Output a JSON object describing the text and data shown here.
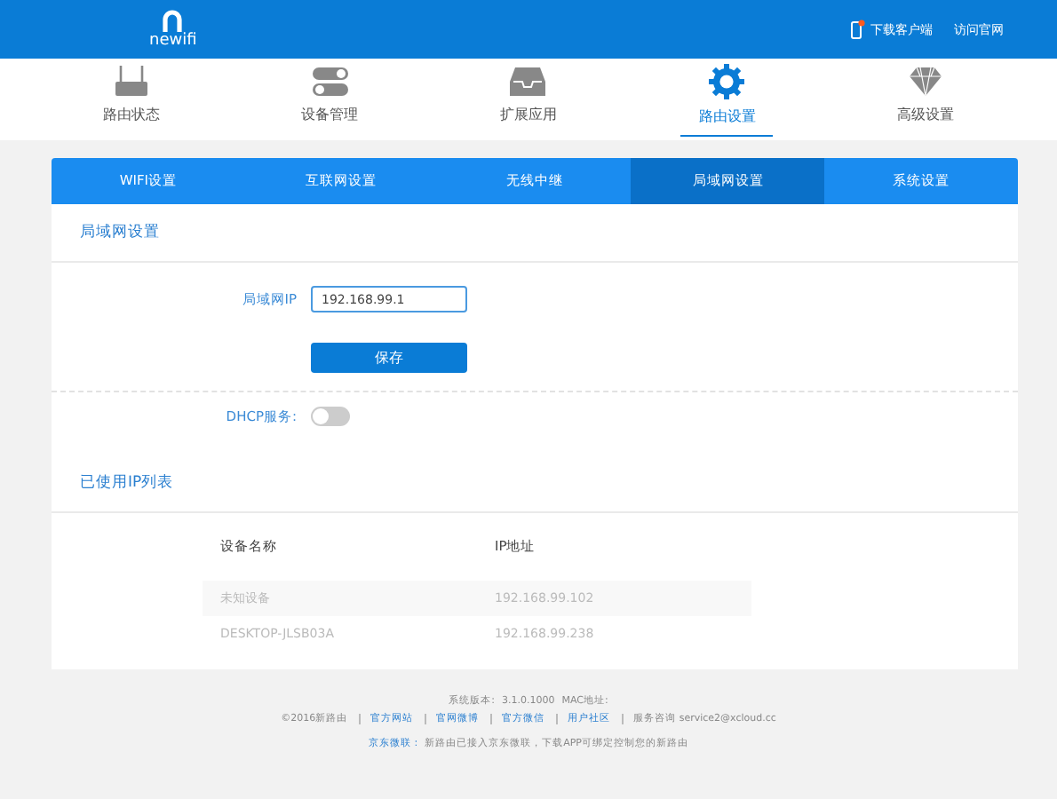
{
  "header": {
    "logo": "newifi",
    "links": [
      {
        "kind": "download",
        "label": "下载客户端"
      },
      {
        "kind": "plain",
        "label": "访问官网"
      }
    ]
  },
  "nav": [
    {
      "label": "路由状态",
      "selected": false
    },
    {
      "label": "设备管理",
      "selected": false
    },
    {
      "label": "扩展应用",
      "selected": false
    },
    {
      "label": "路由设置",
      "selected": true
    },
    {
      "label": "高级设置",
      "selected": false
    }
  ],
  "subtabs": [
    {
      "label": "WIFI设置",
      "selected": false
    },
    {
      "label": "互联网设置",
      "selected": false
    },
    {
      "label": "无线中继",
      "selected": false
    },
    {
      "label": "局域网设置",
      "selected": true
    },
    {
      "label": "系统设置",
      "selected": false
    }
  ],
  "lan": {
    "title": "局域网设置",
    "ip_label": "局域网IP",
    "ip_value": "192.168.99.1",
    "save": "保存",
    "dhcp_label": "DHCP服务:",
    "dhcp_on": false
  },
  "ip_list": {
    "title": "已使用IP列表",
    "columns": [
      "设备名称",
      "IP地址"
    ],
    "rows": [
      {
        "name": "未知设备",
        "ip": "192.168.99.102"
      },
      {
        "name": "DESKTOP-JLSB03A",
        "ip": "192.168.99.238"
      }
    ]
  },
  "footer": {
    "version_label": "系统版本:",
    "version": "3.1.0.1000",
    "mac_label": "MAC地址:",
    "copyright": "©2016新路由",
    "links": [
      "官方网站",
      "官网微博",
      "官方微信",
      "用户社区"
    ],
    "service": "服务咨询 service2@xcloud.cc",
    "jd_label": "京东微联 :",
    "jd_text": "新路由已接入京东微联，下载APP可绑定控制您的新路由"
  }
}
